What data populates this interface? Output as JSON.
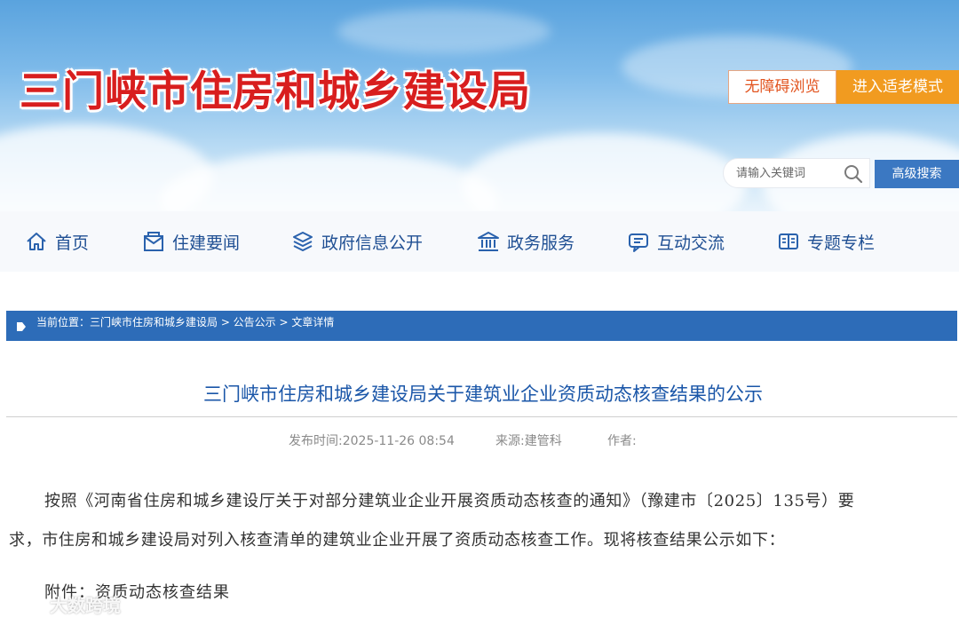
{
  "header": {
    "site_title": "三门峡市住房和城乡建设局",
    "barrier_free": "无障碍浏览",
    "elder_mode": "进入适老模式",
    "search_placeholder": "请输入关键词",
    "advanced_search": "高级搜索"
  },
  "nav": {
    "items": [
      {
        "label": "首页",
        "icon": "home-icon"
      },
      {
        "label": "住建要闻",
        "icon": "news-icon"
      },
      {
        "label": "政府信息公开",
        "icon": "layers-icon"
      },
      {
        "label": "政务服务",
        "icon": "building-icon"
      },
      {
        "label": "互动交流",
        "icon": "chat-icon"
      },
      {
        "label": "专题专栏",
        "icon": "book-icon"
      }
    ]
  },
  "breadcrumb": {
    "text": "当前位置：三门峡市住房和城乡建设局 > 公告公示 > 文章详情"
  },
  "article": {
    "title": "三门峡市住房和城乡建设局关于建筑业企业资质动态核查结果的公示",
    "publish_time": "发布时间:2025-11-26 08:54",
    "source": "来源:建管科",
    "author": "作者:",
    "para1_line1": "按照《河南省住房和城乡建设厅关于对部分建筑业企业开展资质动态核查的通知》（豫建市〔2025〕135号）要",
    "para1_line2": "求，市住房和城乡建设局对列入核查清单的建筑业企业开展了资质动态核查工作。现将核查结果公示如下：",
    "attachment": "附件：资质动态核查结果"
  },
  "watermark": {
    "text": "大数跨境"
  },
  "colors": {
    "title_red": "#d81e1e",
    "nav_blue": "#1f4f93",
    "breadcrumb_bg": "#2d6cb8",
    "elder_orange": "#f19b20",
    "article_title_blue": "#1a56a8"
  }
}
